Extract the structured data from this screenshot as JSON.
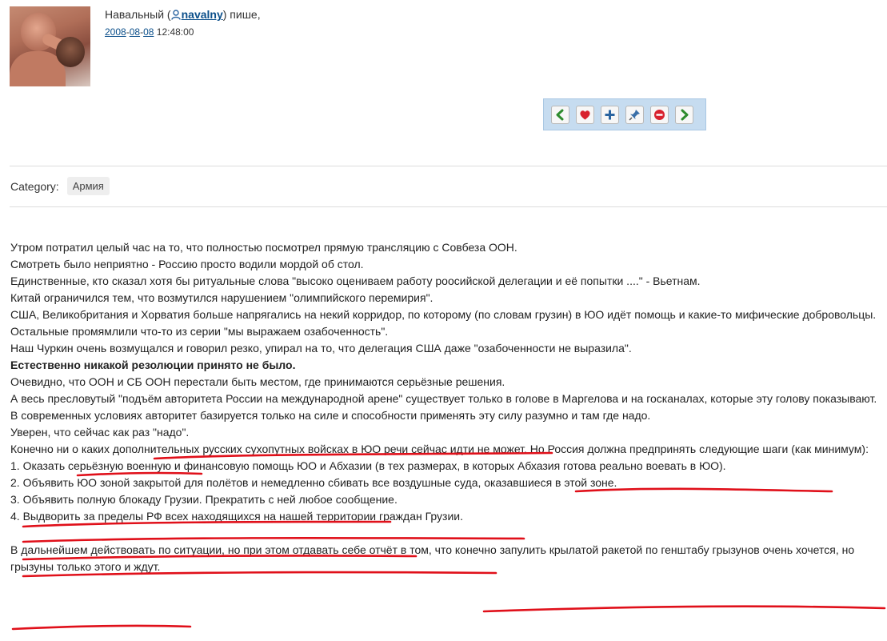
{
  "post": {
    "author_display": "Навальный",
    "open_paren": " (",
    "username": "navalny",
    "close_suffix": ") пише,",
    "date_year": "2008",
    "date_month": "08",
    "date_day": "08",
    "time": "12:48:00"
  },
  "category": {
    "label": "Category:",
    "tag": "Армия"
  },
  "content": {
    "lines": [
      "Утром потратил целый час на то, что полностью посмотрел прямую трансляцию с Совбеза ООН.",
      "Смотреть было неприятно - Россию просто водили мордой об стол.",
      "Единственные, кто сказал хотя бы ритуальные слова \"высоко оцениваем работу роосийской делегации и её попытки ....\" - Вьетнам.",
      "Китай ограничился тем, что возмутился нарушением \"олимпийского перемирия\".",
      "США, Великобритания и Хорватия больше напрягались на некий корридор, по которому (по словам грузин) в ЮО идёт помощь и какие-то мифические добровольцы.",
      "Остальные промямлили что-то из серии \"мы выражаем озабоченность\".",
      "Наш Чуркин очень возмущался и говорил резко, упирал на то, что делегация США даже \"озабоченности не выразила\"."
    ],
    "bold_line": "Естественно никакой резолюции принято не было.",
    "lines2": [
      "Очевидно, что ООН и СБ ООН перестали быть местом, где принимаются серьёзные решения.",
      "А весь пресловутый \"подъём авторитета России на международной арене\" существует только в голове в Маргелова и на госканалах, которые эту голову показывают.",
      "В современных условиях авторитет базируется только на силе и способности применять эту силу разумно и там где надо.",
      "Уверен, что сейчас как раз \"надо\".",
      "Конечно ни о каких дополнительных русских сухопутных войсках в ЮО речи сейчас идти не может. Но Россия должна предпринять следующие шаги (как минимум):",
      "1. Оказать серьёзную военную и финансовую помощь ЮО и Абхазии (в тех размерах, в которых Абхазия готова реально воевать в ЮО).",
      "2. Объявить ЮО зоной закрытой для полётов и немедленно сбивать все воздушные суда, оказавшиеся в этой зоне.",
      "3. Объявить полную блокаду Грузии. Прекратить с ней любое сообщение.",
      "4. Выдворить за пределы РФ всех находящихся на нашей территории граждан Грузии."
    ],
    "final": "В дальнейшем действовать по ситуации, но при этом отдавать себе отчёт в том, что конечно запулить крылатой ракетой по генштабу грызунов очень хочется, но грызуны только этого и ждут."
  },
  "toolbar": {
    "icons": [
      "prev-arrow-icon",
      "heart-icon",
      "plus-icon",
      "pin-icon",
      "stop-icon",
      "next-arrow-icon"
    ]
  },
  "colors": {
    "link": "#0b4f8a",
    "toolbar_bg": "#c6dcf0",
    "underline_marks": "#e0101a"
  }
}
